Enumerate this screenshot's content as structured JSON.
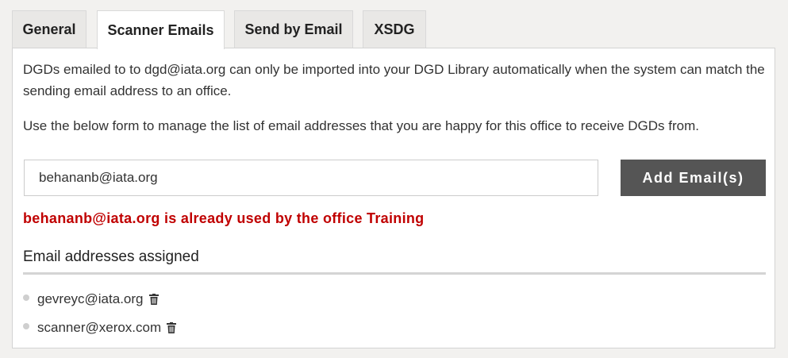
{
  "tabs": [
    {
      "label": "General",
      "active": false
    },
    {
      "label": "Scanner Emails",
      "active": true
    },
    {
      "label": "Send by Email",
      "active": false
    },
    {
      "label": "XSDG",
      "active": false
    }
  ],
  "intro": {
    "paragraph_1": "DGDs emailed to to dgd@iata.org can only be imported into your DGD Library automatically when the system can match the sending email address to an office.",
    "paragraph_2": "Use the below form to manage the list of email addresses that you are happy for this office to receive DGDs from."
  },
  "form": {
    "email_value": "behananb@iata.org",
    "add_button_label": "Add Email(s)",
    "error_message": "behananb@iata.org is already used by the office Training"
  },
  "assigned": {
    "heading": "Email addresses assigned",
    "emails": [
      {
        "address": "gevreyc@iata.org",
        "icon": "trash-icon"
      },
      {
        "address": "scanner@xerox.com",
        "icon": "trash-icon"
      }
    ]
  },
  "colors": {
    "error": "#c00000",
    "button": "#555555",
    "background": "#f2f1ef"
  }
}
